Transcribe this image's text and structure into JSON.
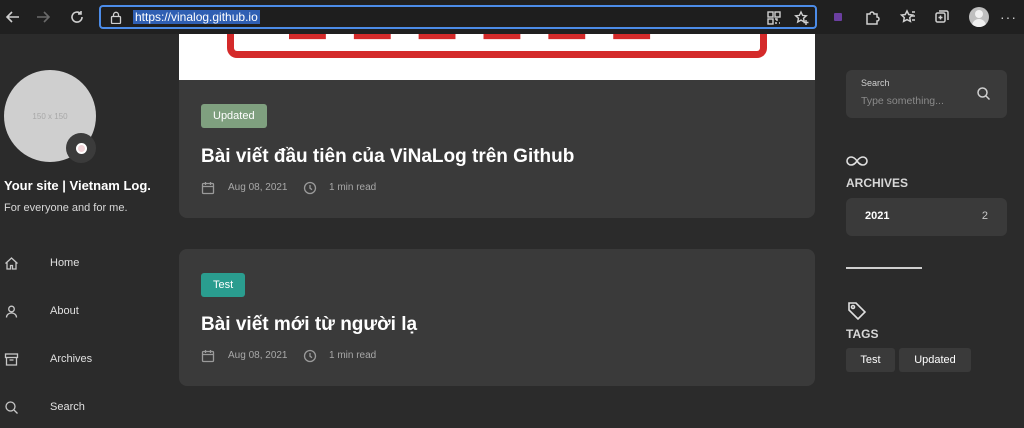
{
  "browser": {
    "url": "https://vinalog.github.io",
    "icons": [
      "back-arrow-icon",
      "forward-arrow-icon",
      "refresh-icon",
      "lock-icon",
      "qr-code-icon",
      "favorite-add-icon",
      "extension-icon",
      "puzzle-icon",
      "favorites-icon",
      "collections-icon",
      "profile-icon",
      "more-icon"
    ]
  },
  "sidebar": {
    "avatar_text": "150 x 150",
    "site_title": "Your site | Vietnam Log.",
    "site_subtitle": "For everyone and for me.",
    "nav": [
      {
        "label": "Home",
        "icon": "home-icon"
      },
      {
        "label": "About",
        "icon": "user-icon"
      },
      {
        "label": "Archives",
        "icon": "archive-icon"
      },
      {
        "label": "Search",
        "icon": "search-icon"
      }
    ]
  },
  "posts": [
    {
      "tag": "Updated",
      "tag_color": "#7fa07f",
      "title": "Bài viết đầu tiên của ViNaLog trên Github",
      "date": "Aug 08, 2021",
      "read_time": "1 min read"
    },
    {
      "tag": "Test",
      "tag_color": "#2a9d8f",
      "title": "Bài viết mới từ người lạ",
      "date": "Aug 08, 2021",
      "read_time": "1 min read"
    }
  ],
  "right": {
    "search": {
      "label": "Search",
      "placeholder": "Type something..."
    },
    "archives": {
      "title": "ARCHIVES",
      "items": [
        {
          "year": "2021",
          "count": "2"
        }
      ]
    },
    "tags": {
      "title": "TAGS",
      "items": [
        "Test",
        "Updated"
      ]
    }
  },
  "colors": {
    "background": "#2b2b2b",
    "card": "#3a3a3a",
    "accent_url": "#4c8ce8"
  }
}
